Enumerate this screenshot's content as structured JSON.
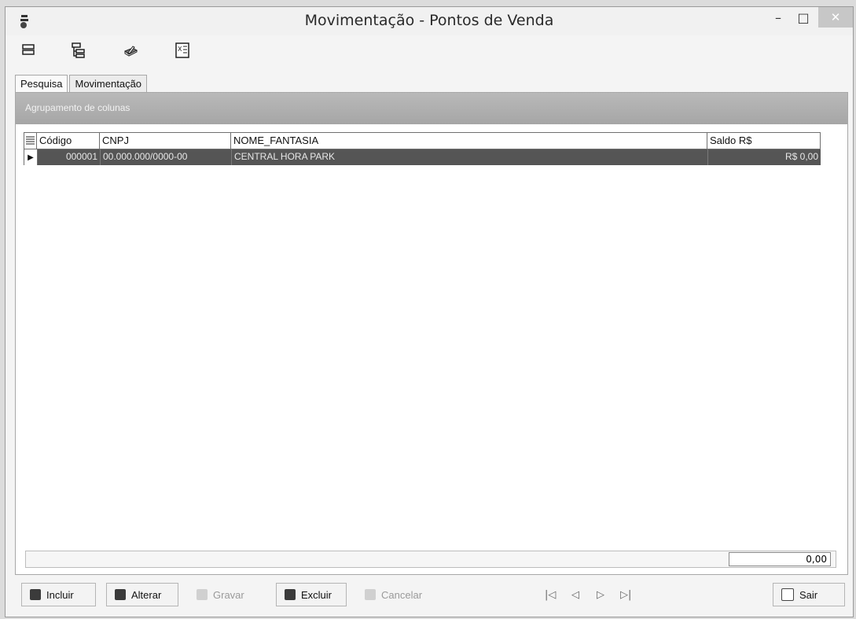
{
  "window": {
    "title": "Movimentação - Pontos de Venda",
    "minimize_symbol": "–",
    "maximize_symbol": "□",
    "close_symbol": "✕"
  },
  "toolbar": {
    "icons": [
      "list-view-icon",
      "tree-view-icon",
      "print-icon",
      "excel-export-icon"
    ]
  },
  "tabs": {
    "pesquisa": "Pesquisa",
    "movimentacao": "Movimentação"
  },
  "grid": {
    "group_label": "Agrupamento de colunas",
    "columns": {
      "codigo": "Código",
      "cnpj": "CNPJ",
      "nome_fantasia": "NOME_FANTASIA",
      "saldo": "Saldo R$"
    },
    "rows": [
      {
        "codigo": "000001",
        "cnpj": "00.000.000/0000-00",
        "nome_fantasia": "CENTRAL HORA PARK",
        "saldo": "R$ 0,00"
      }
    ],
    "total": "0,00"
  },
  "buttons": {
    "incluir": "Incluir",
    "alterar": "Alterar",
    "gravar": "Gravar",
    "excluir": "Excluir",
    "cancelar": "Cancelar",
    "sair": "Sair"
  },
  "navigation": {
    "first": "|◁",
    "prev": "◁",
    "next": "▷",
    "last": "▷|"
  }
}
